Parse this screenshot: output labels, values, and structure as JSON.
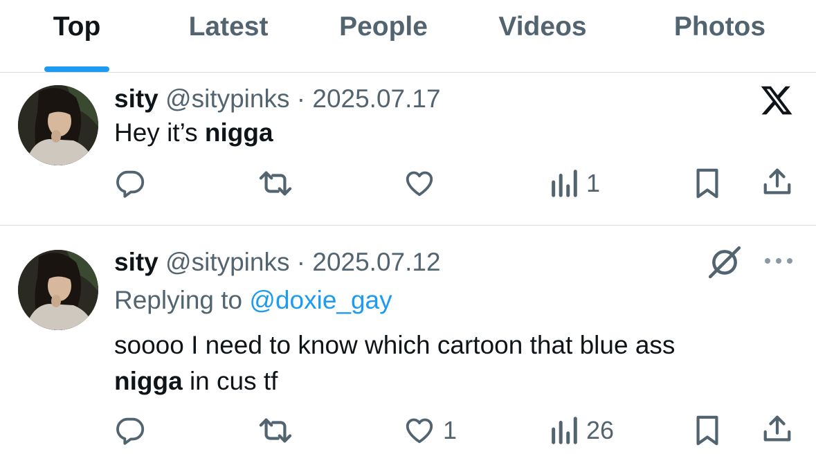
{
  "tabs": [
    {
      "label": "Top",
      "active": true
    },
    {
      "label": "Latest",
      "active": false
    },
    {
      "label": "People",
      "active": false
    },
    {
      "label": "Videos",
      "active": false
    },
    {
      "label": "Photos",
      "active": false
    }
  ],
  "colors": {
    "accent": "#1d9bf0",
    "secondary_text": "#536471",
    "primary_text": "#0f1419",
    "divider": "#d6dde3"
  },
  "tweets": [
    {
      "name": "sity",
      "handle": "@sitypinks",
      "separator": "·",
      "date": "2025.07.17",
      "text_plain": "Hey it’s ",
      "text_bold": "nigga",
      "corner_icon": "x-logo-icon",
      "views": "1",
      "likes": ""
    },
    {
      "name": "sity",
      "handle": "@sitypinks",
      "separator": "·",
      "date": "2025.07.12",
      "replying_prefix": "Replying to ",
      "replying_handle": "@doxie_gay",
      "text_line1": "soooo I need to know which cartoon that blue ass",
      "text_line2_bold": "nigga",
      "text_line2_rest": " in cus tf",
      "corner_icon": "grok-icon",
      "more_icon": "more-dots-icon",
      "likes": "1",
      "views": "26"
    }
  ]
}
